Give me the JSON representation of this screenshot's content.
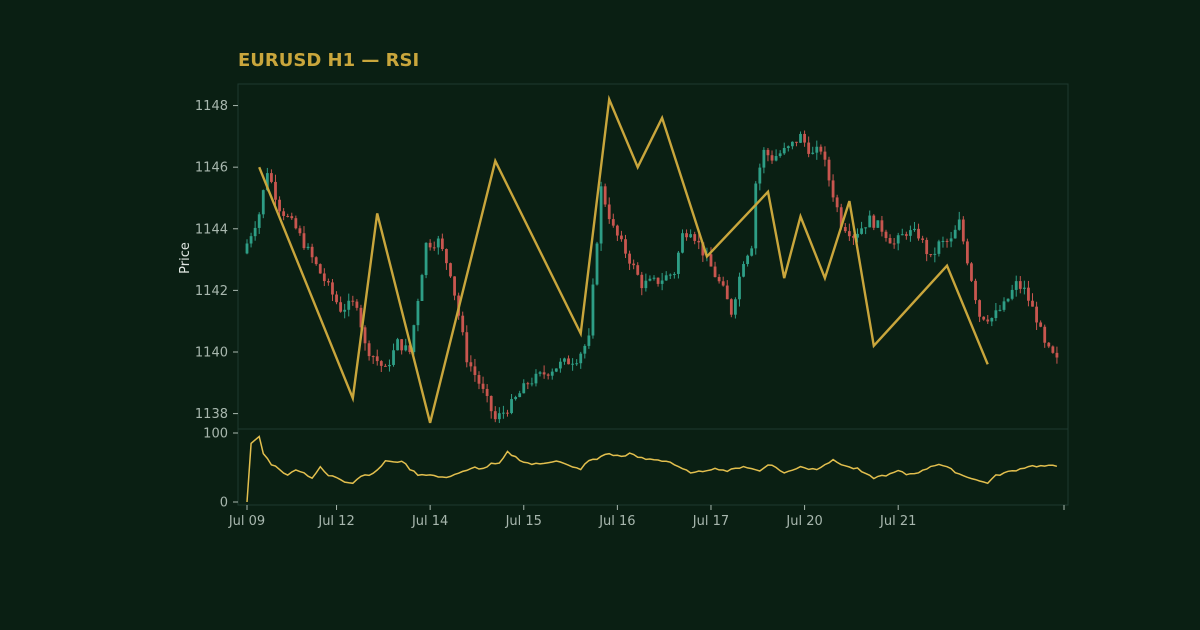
{
  "colors": {
    "background": "#0a1f13",
    "plot_border": "#1e3a2f",
    "title": "#c9a63c",
    "tick_text": "#a8b7ae",
    "axis_title": "#dfe6e1",
    "bull": "#2e9e86",
    "bear": "#c8564f",
    "zigzag": "#c9a63c",
    "rsi": "#e2bf4e"
  },
  "chart_data": {
    "type": "candlestick",
    "title": "EURUSD H1 — RSI",
    "price_panel": {
      "ylabel": "Price",
      "ylim": [
        1137.5,
        1148.7
      ],
      "yticks": [
        1138,
        1140,
        1142,
        1144,
        1146,
        1148
      ],
      "candle_count": 200,
      "anchors": [
        [
          0,
          1143.2
        ],
        [
          4,
          1144.5
        ],
        [
          6,
          1145.9
        ],
        [
          9,
          1144.7
        ],
        [
          13,
          1144.0
        ],
        [
          18,
          1142.8
        ],
        [
          24,
          1141.4
        ],
        [
          28,
          1141.6
        ],
        [
          30,
          1140.2
        ],
        [
          35,
          1139.4
        ],
        [
          38,
          1140.3
        ],
        [
          41,
          1140.0
        ],
        [
          45,
          1143.5
        ],
        [
          48,
          1143.6
        ],
        [
          51,
          1142.6
        ],
        [
          55,
          1139.8
        ],
        [
          58,
          1139.0
        ],
        [
          62,
          1137.8
        ],
        [
          66,
          1138.3
        ],
        [
          70,
          1139.0
        ],
        [
          74,
          1139.3
        ],
        [
          78,
          1139.6
        ],
        [
          82,
          1139.8
        ],
        [
          85,
          1140.4
        ],
        [
          88,
          1145.3
        ],
        [
          91,
          1144.0
        ],
        [
          95,
          1143.0
        ],
        [
          98,
          1142.2
        ],
        [
          102,
          1142.3
        ],
        [
          106,
          1142.6
        ],
        [
          108,
          1143.8
        ],
        [
          110,
          1144.0
        ],
        [
          114,
          1143.0
        ],
        [
          118,
          1142.0
        ],
        [
          120,
          1141.3
        ],
        [
          123,
          1143.0
        ],
        [
          125,
          1143.5
        ],
        [
          126,
          1145.5
        ],
        [
          128,
          1146.5
        ],
        [
          130,
          1146.3
        ],
        [
          134,
          1146.6
        ],
        [
          137,
          1147.0
        ],
        [
          140,
          1146.4
        ],
        [
          142,
          1146.6
        ],
        [
          144,
          1145.6
        ],
        [
          147,
          1144.2
        ],
        [
          150,
          1143.8
        ],
        [
          154,
          1144.3
        ],
        [
          157,
          1144.0
        ],
        [
          160,
          1143.5
        ],
        [
          163,
          1143.9
        ],
        [
          166,
          1143.8
        ],
        [
          169,
          1143.0
        ],
        [
          171,
          1143.5
        ],
        [
          174,
          1143.6
        ],
        [
          176,
          1144.2
        ],
        [
          178,
          1143.0
        ],
        [
          181,
          1141.2
        ],
        [
          184,
          1141.1
        ],
        [
          187,
          1141.5
        ],
        [
          190,
          1142.2
        ],
        [
          192,
          1142.0
        ],
        [
          195,
          1141.1
        ],
        [
          197,
          1140.2
        ],
        [
          200,
          1139.7
        ],
        [
          202,
          1140.6
        ],
        [
          205,
          1140.8
        ]
      ],
      "zigzag": [
        [
          3,
          1146.0
        ],
        [
          26,
          1138.5
        ],
        [
          32,
          1144.5
        ],
        [
          45,
          1137.7
        ],
        [
          61,
          1146.2
        ],
        [
          82,
          1140.6
        ],
        [
          89,
          1148.2
        ],
        [
          96,
          1146.0
        ],
        [
          102,
          1147.6
        ],
        [
          113,
          1143.1
        ],
        [
          128,
          1145.2
        ],
        [
          132,
          1142.4
        ],
        [
          136,
          1144.4
        ],
        [
          142,
          1142.4
        ],
        [
          148,
          1144.9
        ],
        [
          154,
          1140.2
        ],
        [
          172,
          1142.8
        ],
        [
          182,
          1139.6
        ]
      ]
    },
    "rsi_panel": {
      "ylim": [
        0,
        100
      ],
      "yticks": [
        0,
        100
      ],
      "anchors": [
        [
          0,
          0
        ],
        [
          1,
          85
        ],
        [
          3,
          95
        ],
        [
          4,
          70
        ],
        [
          6,
          55
        ],
        [
          8,
          48
        ],
        [
          10,
          38
        ],
        [
          12,
          48
        ],
        [
          14,
          42
        ],
        [
          16,
          35
        ],
        [
          18,
          50
        ],
        [
          20,
          38
        ],
        [
          22,
          36
        ],
        [
          24,
          30
        ],
        [
          26,
          28
        ],
        [
          28,
          38
        ],
        [
          30,
          40
        ],
        [
          32,
          45
        ],
        [
          34,
          60
        ],
        [
          36,
          57
        ],
        [
          38,
          60
        ],
        [
          40,
          48
        ],
        [
          42,
          40
        ],
        [
          44,
          40
        ],
        [
          46,
          38
        ],
        [
          48,
          35
        ],
        [
          50,
          38
        ],
        [
          52,
          42
        ],
        [
          54,
          45
        ],
        [
          56,
          50
        ],
        [
          58,
          48
        ],
        [
          60,
          55
        ],
        [
          62,
          55
        ],
        [
          64,
          72
        ],
        [
          66,
          65
        ],
        [
          68,
          58
        ],
        [
          70,
          55
        ],
        [
          72,
          55
        ],
        [
          74,
          58
        ],
        [
          76,
          60
        ],
        [
          78,
          55
        ],
        [
          80,
          50
        ],
        [
          82,
          48
        ],
        [
          84,
          60
        ],
        [
          86,
          62
        ],
        [
          88,
          70
        ],
        [
          90,
          68
        ],
        [
          92,
          66
        ],
        [
          94,
          70
        ],
        [
          96,
          65
        ],
        [
          98,
          62
        ],
        [
          100,
          62
        ],
        [
          102,
          60
        ],
        [
          104,
          58
        ],
        [
          106,
          50
        ],
        [
          108,
          45
        ],
        [
          110,
          42
        ],
        [
          112,
          45
        ],
        [
          114,
          48
        ],
        [
          116,
          48
        ],
        [
          118,
          45
        ],
        [
          120,
          48
        ],
        [
          122,
          52
        ],
        [
          124,
          48
        ],
        [
          126,
          45
        ],
        [
          128,
          55
        ],
        [
          130,
          50
        ],
        [
          132,
          42
        ],
        [
          134,
          46
        ],
        [
          136,
          52
        ],
        [
          138,
          48
        ],
        [
          140,
          48
        ],
        [
          142,
          55
        ],
        [
          144,
          60
        ],
        [
          146,
          55
        ],
        [
          148,
          50
        ],
        [
          150,
          48
        ],
        [
          152,
          40
        ],
        [
          154,
          35
        ],
        [
          156,
          38
        ],
        [
          158,
          40
        ],
        [
          160,
          45
        ],
        [
          162,
          40
        ],
        [
          164,
          42
        ],
        [
          166,
          45
        ],
        [
          168,
          52
        ],
        [
          170,
          55
        ],
        [
          172,
          50
        ],
        [
          174,
          44
        ],
        [
          176,
          38
        ],
        [
          178,
          35
        ],
        [
          180,
          30
        ],
        [
          182,
          28
        ],
        [
          184,
          38
        ],
        [
          186,
          42
        ],
        [
          188,
          45
        ],
        [
          190,
          48
        ],
        [
          192,
          52
        ],
        [
          200,
          52
        ]
      ]
    },
    "xaxis": {
      "tick_labels": [
        "Jul 09",
        "Jul 12",
        "Jul 14",
        "Jul 15",
        "Jul 16",
        "Jul 17",
        "Jul 20",
        "Jul 21"
      ],
      "tick_index": [
        0,
        22,
        45,
        68,
        91,
        114,
        137,
        160
      ]
    }
  }
}
